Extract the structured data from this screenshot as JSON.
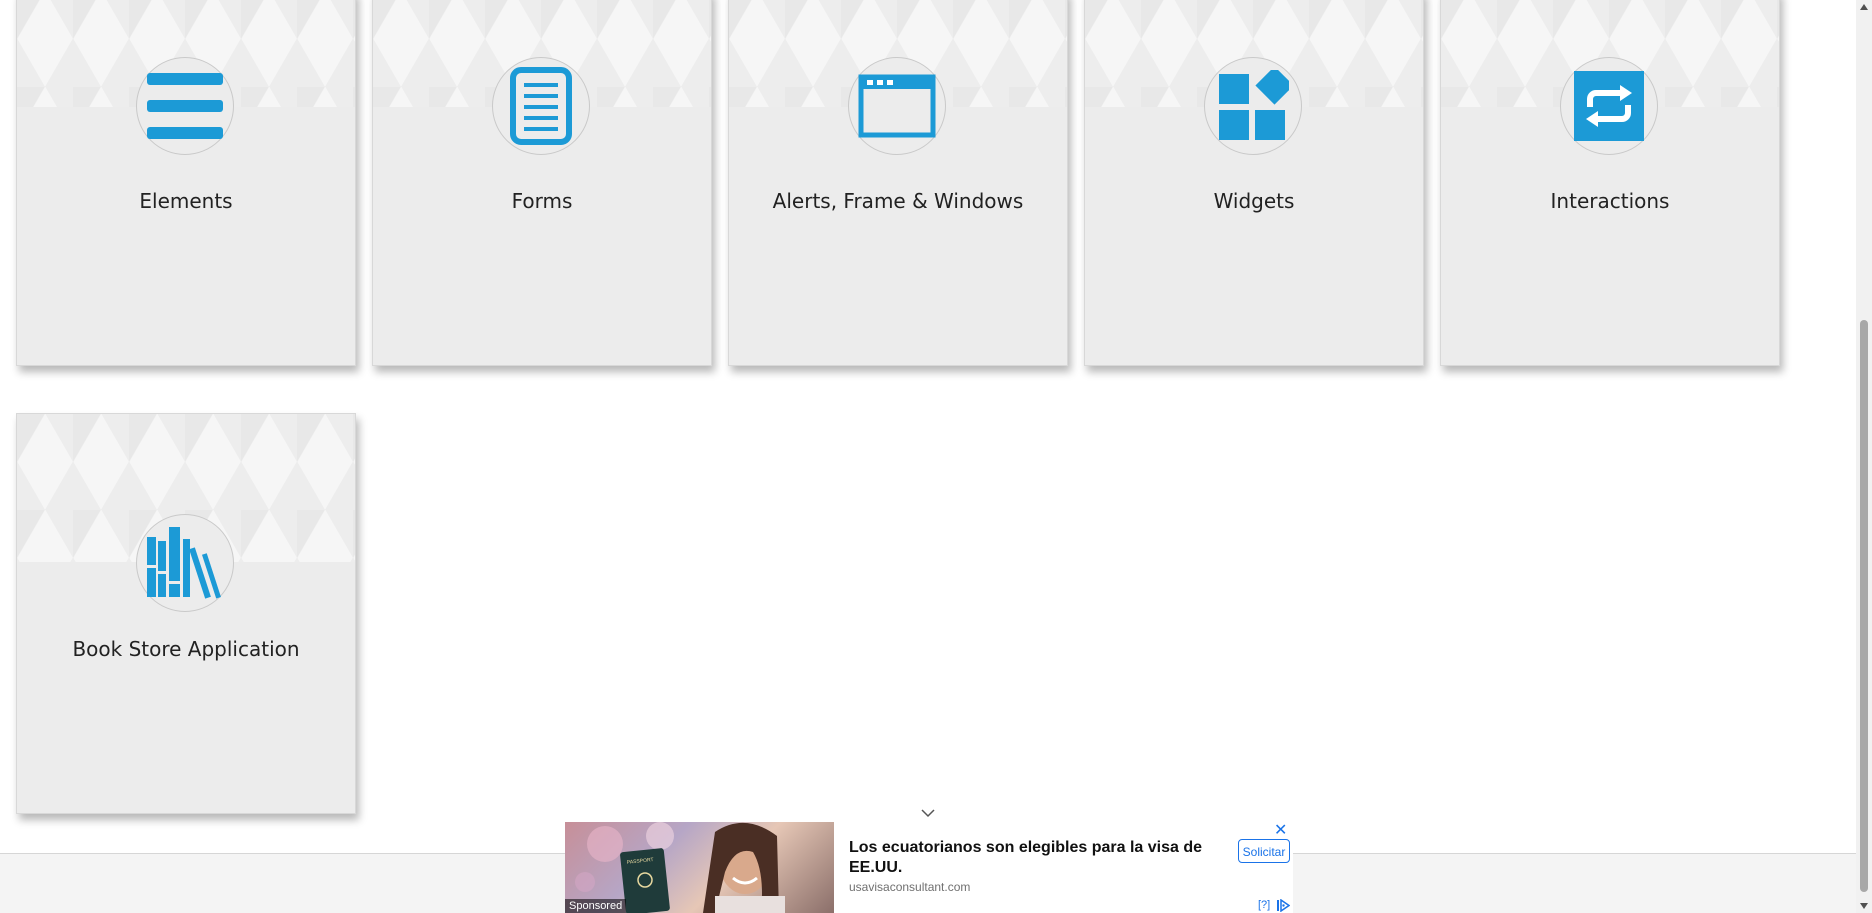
{
  "cards": [
    {
      "title": "Elements",
      "icon": "hamburger-list-icon"
    },
    {
      "title": "Forms",
      "icon": "document-form-icon"
    },
    {
      "title": "Alerts, Frame & Windows",
      "icon": "browser-window-icon"
    },
    {
      "title": "Widgets",
      "icon": "widgets-grid-icon"
    },
    {
      "title": "Interactions",
      "icon": "repeat-arrows-icon"
    },
    {
      "title": "Book Store Application",
      "icon": "books-icon"
    }
  ],
  "ad": {
    "headline": "Los ecuatorianos son elegibles para la visa de EE.UU.",
    "domain": "usavisaconsultant.com",
    "cta": "Solicitar",
    "sponsored": "Sponsored",
    "close": "✕",
    "choices": "[?]",
    "passport_text": "PASSPORT"
  },
  "colors": {
    "accent": "#1c9ad6",
    "card_bg": "#ececec",
    "ad_link": "#1a73e8"
  }
}
